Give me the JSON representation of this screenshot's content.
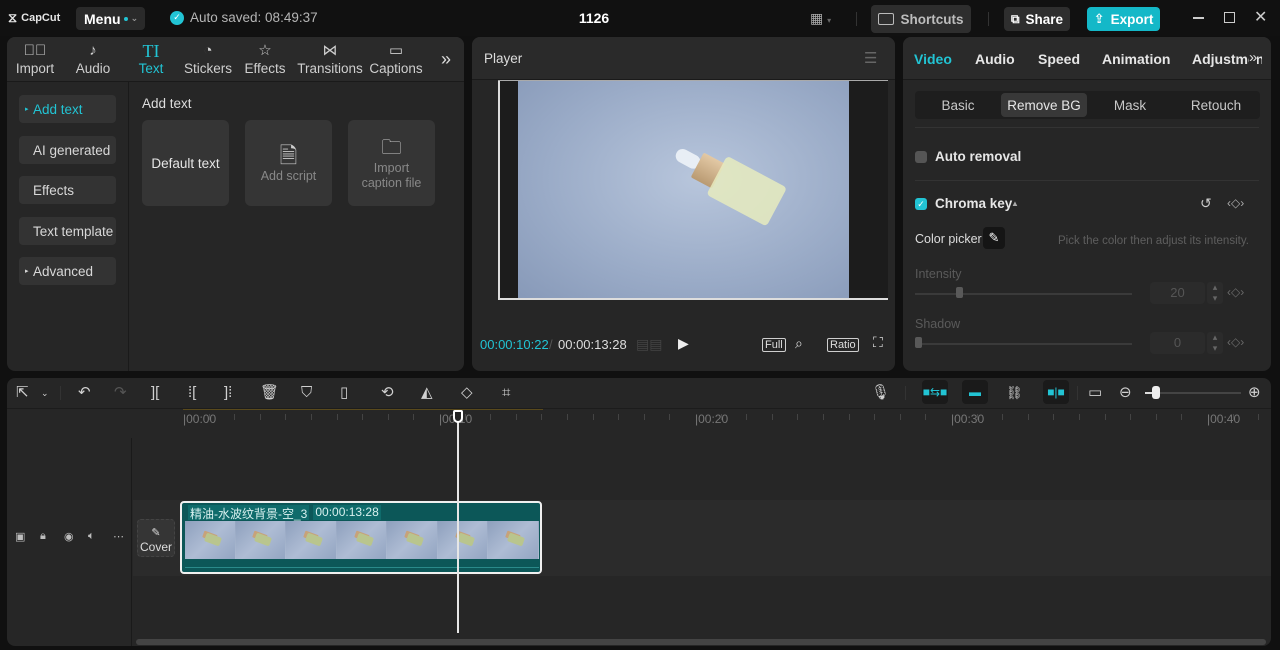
{
  "app": {
    "logo": "CapCut",
    "menu_label": "Menu",
    "autosave": "Auto saved: 08:49:37",
    "project_title": "1126",
    "shortcuts_label": "Shortcuts",
    "share_label": "Share",
    "export_label": "Export",
    "accent_color": "#22c4d4"
  },
  "library": {
    "tabs": [
      {
        "label": "Import",
        "icon": "import-icon"
      },
      {
        "label": "Audio",
        "icon": "audio-icon"
      },
      {
        "label": "Text",
        "icon": "text-icon",
        "active": true
      },
      {
        "label": "Stickers",
        "icon": "stickers-icon"
      },
      {
        "label": "Effects",
        "icon": "effects-icon"
      },
      {
        "label": "Transitions",
        "icon": "transitions-icon"
      },
      {
        "label": "Captions",
        "icon": "captions-icon"
      }
    ],
    "side_items": [
      {
        "label": "Add text",
        "active": true,
        "expandable": true
      },
      {
        "label": "AI generated"
      },
      {
        "label": "Effects"
      },
      {
        "label": "Text template"
      },
      {
        "label": "Advanced",
        "expandable": true
      }
    ],
    "section_title": "Add text",
    "cards": [
      {
        "label": "Default text"
      },
      {
        "label": "Add script",
        "icon": "script-icon"
      },
      {
        "label": "Import caption file",
        "icon": "folder-icon"
      }
    ]
  },
  "player": {
    "title": "Player",
    "current_time": "00:00:10:22",
    "separator": "/",
    "total_time": "00:00:13:28",
    "full_label": "Full",
    "ratio_label": "Ratio"
  },
  "inspector": {
    "tabs": [
      "Video",
      "Audio",
      "Speed",
      "Animation",
      "Adjustment"
    ],
    "active_tab": "Video",
    "subtabs": [
      "Basic",
      "Remove BG",
      "Mask",
      "Retouch"
    ],
    "active_subtab": "Remove BG",
    "auto_removal": {
      "label": "Auto removal",
      "checked": false
    },
    "chroma_key": {
      "label": "Chroma key",
      "checked": true
    },
    "color_picker_label": "Color picker",
    "hint": "Pick the color then adjust its intensity.",
    "intensity": {
      "label": "Intensity",
      "value": "20",
      "fraction": 0.2
    },
    "shadow": {
      "label": "Shadow",
      "value": "0",
      "fraction": 0.0
    }
  },
  "timeline": {
    "ruler_labels": [
      "00:00",
      "00:10",
      "00:20",
      "00:30",
      "00:40"
    ],
    "clip": {
      "name": "精油-水波纹背景-空_3",
      "duration": "00:00:13:28"
    },
    "cover_label": "Cover",
    "zoom_fraction": 0.08
  }
}
